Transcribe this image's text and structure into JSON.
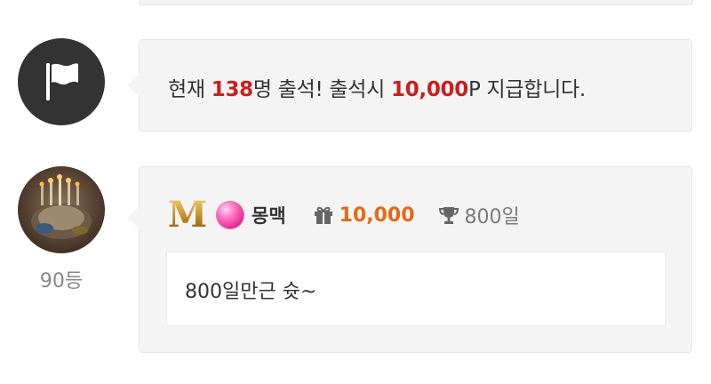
{
  "notice": {
    "prefix": "현재 ",
    "count": "138",
    "middle": "명 출석! 출석시 ",
    "points": "10,000",
    "suffix": "P 지급합니다.",
    "icon": "flag-icon"
  },
  "comment": {
    "rank": "90등",
    "level_badge": "M",
    "nickname": "몽맥",
    "gift_points": "10,000",
    "attendance_days": "800일",
    "text": "800일만근 슛~",
    "icons": [
      "gift-icon",
      "trophy-icon",
      "pink-orb-icon"
    ]
  },
  "colors": {
    "highlight_red": "#c8201f",
    "points_orange": "#e26a1a",
    "bubble_bg": "#f4f4f4",
    "icon_circle": "#333333"
  }
}
